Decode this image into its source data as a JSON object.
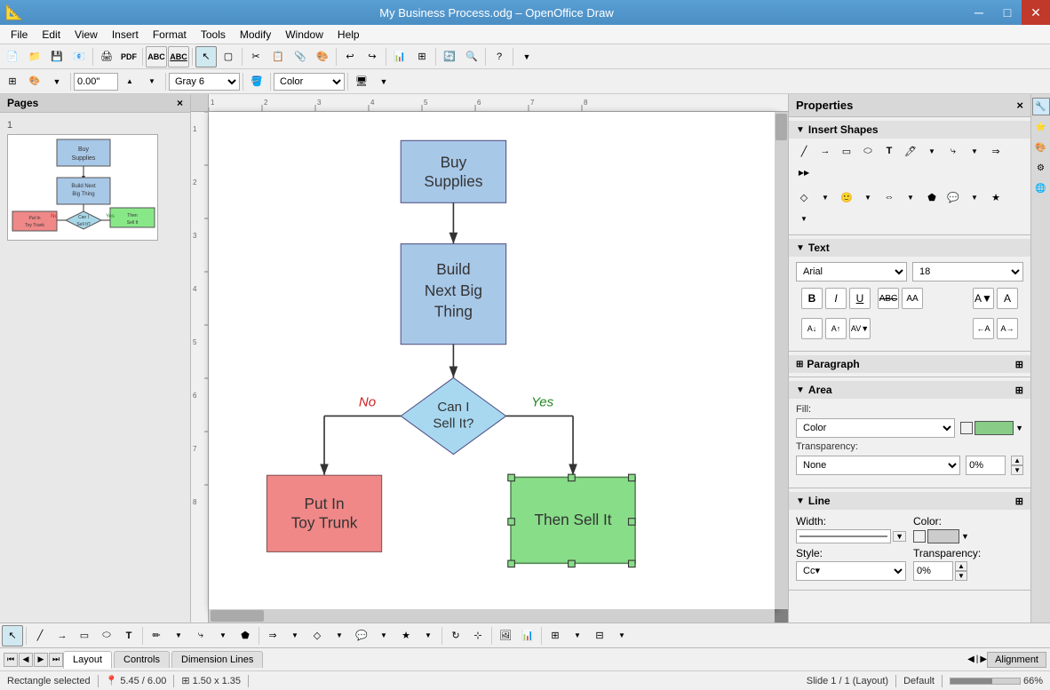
{
  "window": {
    "title": "My Business Process.odg – OpenOffice Draw",
    "app_icon": "📐"
  },
  "titlebar": {
    "title": "My Business Process.odg – OpenOffice Draw",
    "minimize": "─",
    "maximize": "□",
    "close": "✕"
  },
  "menubar": {
    "items": [
      "File",
      "Edit",
      "View",
      "Insert",
      "Format",
      "Tools",
      "Modify",
      "Window",
      "Help"
    ]
  },
  "toolbar1": {
    "buttons": [
      "📁",
      "💾",
      "🖨",
      "✂",
      "📋",
      "↩",
      "↪",
      "📊",
      "🌐",
      "🔍",
      "?"
    ]
  },
  "toolbar2": {
    "position_value": "0.00\"",
    "fill_color": "Gray 6",
    "fill_type": "Color"
  },
  "pages_panel": {
    "title": "Pages",
    "close": "×",
    "page_number": "1"
  },
  "properties_panel": {
    "title": "Properties",
    "close": "×",
    "sections": {
      "insert_shapes": {
        "label": "Insert Shapes",
        "collapsed": false
      },
      "text": {
        "label": "Text",
        "collapsed": false,
        "font": "Arial",
        "font_size": "18",
        "bold": "B",
        "italic": "I",
        "underline": "U",
        "strikethrough": "ABC",
        "uppercase": "AA",
        "shadow_label": "A",
        "color_label": "A"
      },
      "paragraph": {
        "label": "Paragraph",
        "collapsed": true
      },
      "area": {
        "label": "Area",
        "collapsed": false,
        "fill_label": "Fill:",
        "fill_value": "Color",
        "transparency_label": "Transparency:",
        "transparency_value": "None",
        "transparency_pct": "0%",
        "fill_color": "#88cc88"
      },
      "line": {
        "label": "Line",
        "collapsed": false,
        "width_label": "Width:",
        "color_label": "Color:",
        "style_label": "Style:",
        "transparency_label": "Transparency:",
        "width_value": "",
        "color_value": "#cccccc",
        "style_value": "Cc▾",
        "transparency_value": "0%"
      }
    }
  },
  "flowchart": {
    "buy_supplies": "Buy\nSupplies",
    "build_next": "Build\nNext Big\nThing",
    "can_sell": "Can I\nSell It?",
    "put_in_trunk": "Put In\nToy Trunk",
    "then_sell_it": "Then Sell It",
    "yes_label": "Yes",
    "no_label": "No"
  },
  "tabs": {
    "items": [
      "Layout",
      "Controls",
      "Dimension Lines"
    ],
    "active": "Layout",
    "alignment_btn": "Alignment"
  },
  "status_bar": {
    "status": "Rectangle selected",
    "position": "5.45 / 6.00",
    "size": "1.50 x 1.35",
    "slide": "Slide 1 / 1 (Layout)",
    "theme": "Default",
    "zoom": "66%"
  }
}
